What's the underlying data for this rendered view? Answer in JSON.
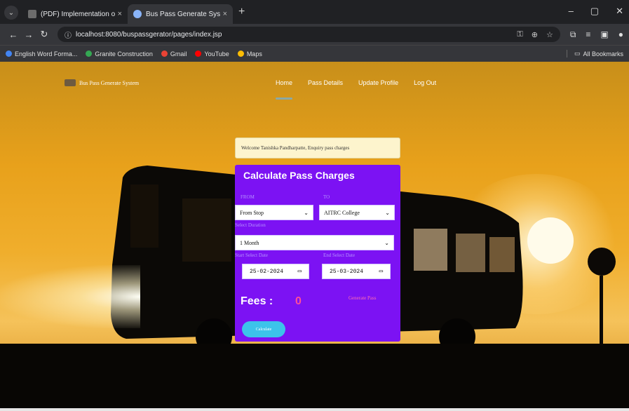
{
  "browser": {
    "menu_icon": "chevron-down-icon",
    "tabs": [
      {
        "title": "(PDF) Implementation of an Eff",
        "favicon_color": "#6c6c6c"
      },
      {
        "title": "Bus Pass Generate System",
        "favicon_color": "#8ab4f8"
      }
    ],
    "tab_close": "×",
    "new_tab": "+",
    "window_controls": [
      "–",
      "▢",
      "✕"
    ],
    "nav": {
      "back": "←",
      "forward": "→",
      "reload": "↻"
    },
    "url": "localhost:8080/buspassgerator/pages/index.jsp",
    "omnibox_icons": [
      "key-icon",
      "zoom-icon",
      "star-icon"
    ],
    "bookmarks": [
      {
        "label": "English Word Forma...",
        "color": "#4285f4"
      },
      {
        "label": "Granite Construction",
        "color": "#34a853"
      },
      {
        "label": "Gmail",
        "color": "#ea4335"
      },
      {
        "label": "YouTube",
        "color": "#ff0000"
      },
      {
        "label": "Maps",
        "color": "#fbbc04"
      }
    ],
    "all_bookmarks": "All Bookmarks"
  },
  "site": {
    "brand": "Bus Pass Generate System",
    "menu": [
      {
        "label": "Home",
        "active": true
      },
      {
        "label": "Pass Details",
        "active": false
      },
      {
        "label": "Update Profile",
        "active": false
      },
      {
        "label": "Log Out",
        "active": false
      }
    ],
    "welcome": "Welcome Tanishka Pandharpatte, Enquiry pass charges"
  },
  "form": {
    "title": "Calculate Pass Charges",
    "from_label": "FROM",
    "from_value": "From Stop",
    "to_label": "TO",
    "to_value": "AITRC College",
    "duration_label": "Select Duration",
    "duration_value": "1 Month",
    "start_label": "Start Select Date",
    "start_value": "25-02-2024",
    "end_label": "End Select Date",
    "end_value": "25-03-2024",
    "fees_label": "Fees :",
    "fees_value": "0",
    "generate_pass": "Generate Pass",
    "calculate": "Calculate"
  },
  "colors": {
    "card": "#7c12f3",
    "calc_button": "#3cc3ea",
    "fees_value": "#ff4d9a"
  }
}
